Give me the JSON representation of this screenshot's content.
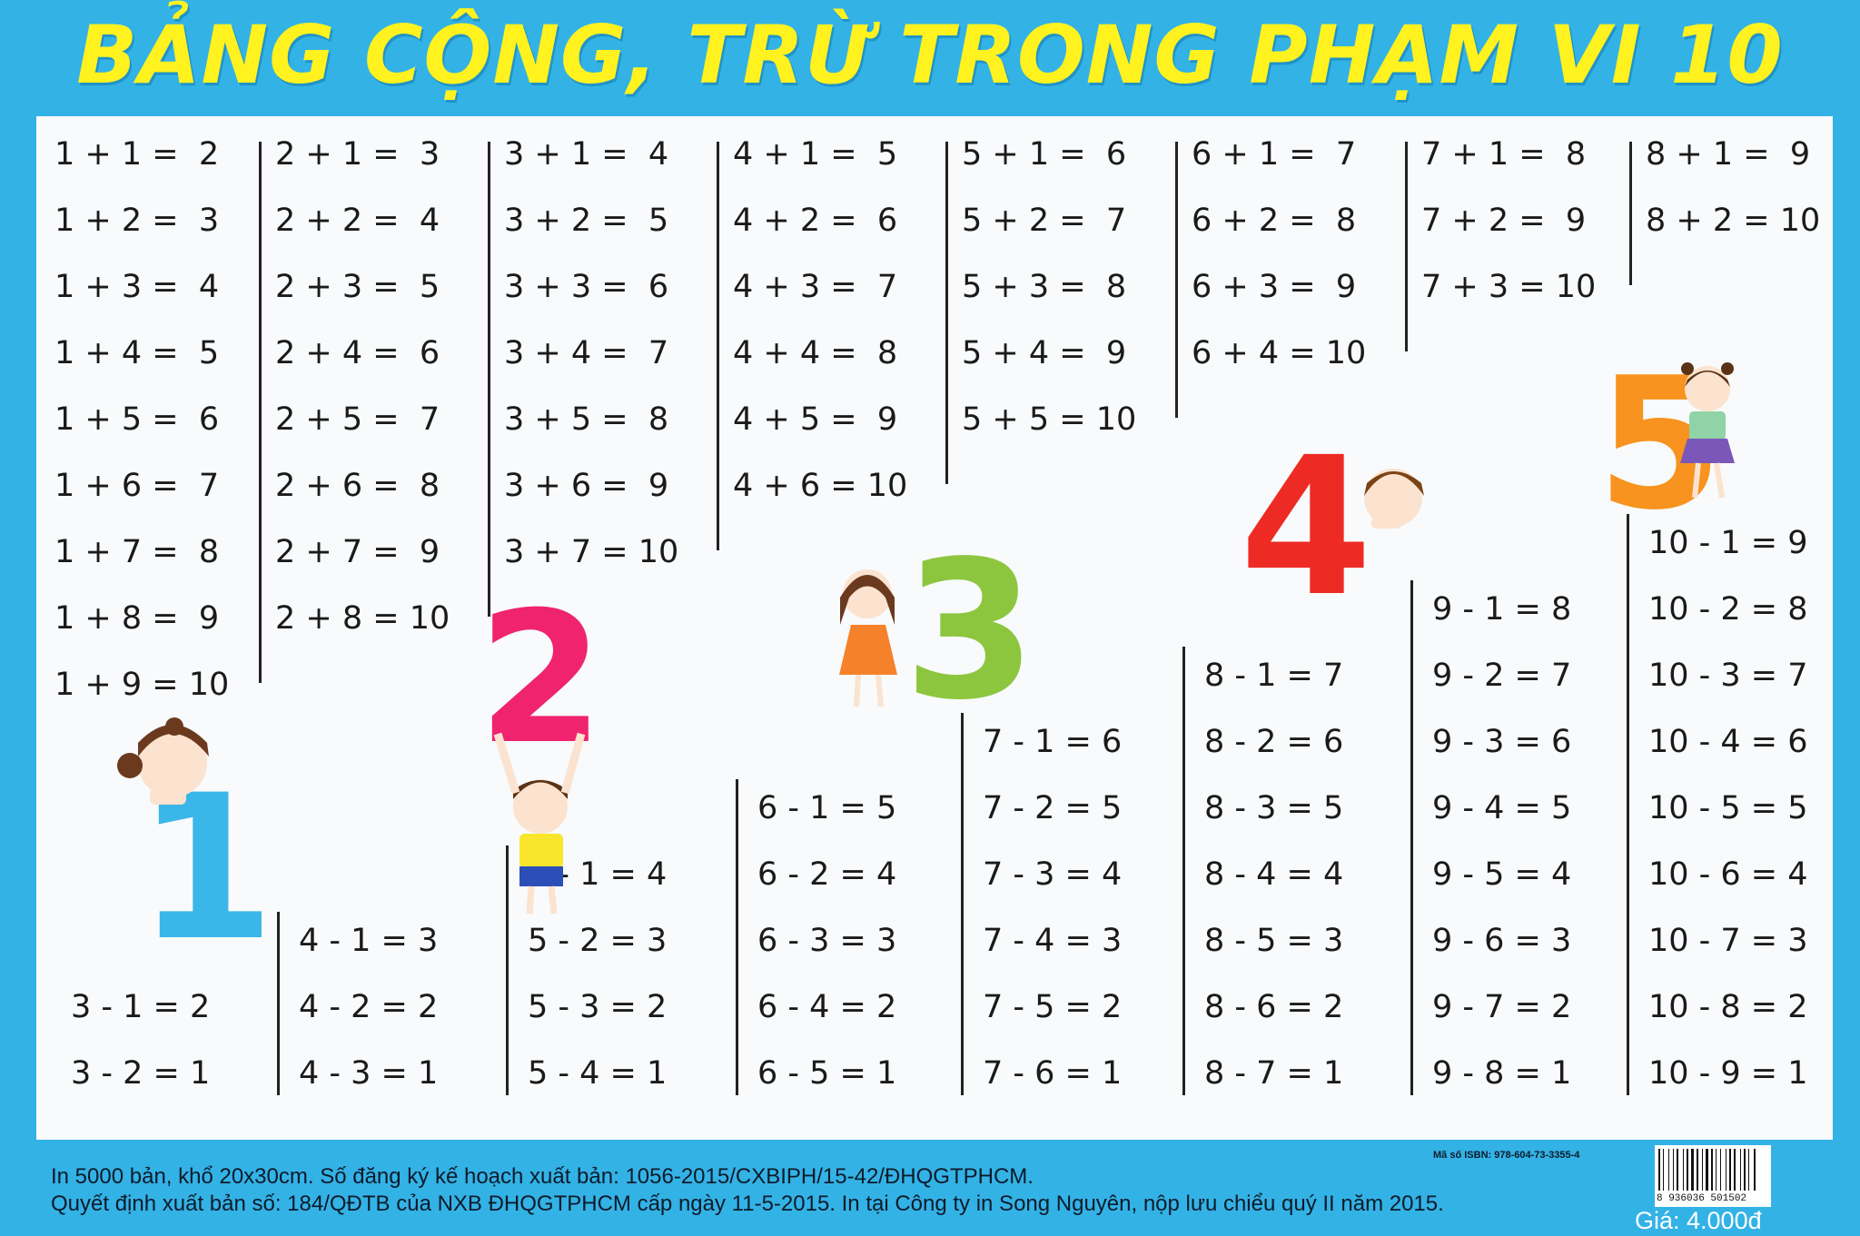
{
  "title": "BẢNG CỘNG, TRỪ TRONG PHẠM VI 10",
  "addition_columns": [
    [
      "1 + 1 =  2",
      "1 + 2 =  3",
      "1 + 3 =  4",
      "1 + 4 =  5",
      "1 + 5 =  6",
      "1 + 6 =  7",
      "1 + 7 =  8",
      "1 + 8 =  9",
      "1 + 9 = 10"
    ],
    [
      "2 + 1 =  3",
      "2 + 2 =  4",
      "2 + 3 =  5",
      "2 + 4 =  6",
      "2 + 5 =  7",
      "2 + 6 =  8",
      "2 + 7 =  9",
      "2 + 8 = 10"
    ],
    [
      "3 + 1 =  4",
      "3 + 2 =  5",
      "3 + 3 =  6",
      "3 + 4 =  7",
      "3 + 5 =  8",
      "3 + 6 =  9",
      "3 + 7 = 10"
    ],
    [
      "4 + 1 =  5",
      "4 + 2 =  6",
      "4 + 3 =  7",
      "4 + 4 =  8",
      "4 + 5 =  9",
      "4 + 6 = 10"
    ],
    [
      "5 + 1 =  6",
      "5 + 2 =  7",
      "5 + 3 =  8",
      "5 + 4 =  9",
      "5 + 5 = 10"
    ],
    [
      "6 + 1 =  7",
      "6 + 2 =  8",
      "6 + 3 =  9",
      "6 + 4 = 10"
    ],
    [
      "7 + 1 =  8",
      "7 + 2 =  9",
      "7 + 3 = 10"
    ],
    [
      "8 + 1 =  9",
      "8 + 2 = 10"
    ]
  ],
  "subtraction_columns": [
    [
      "3 - 1 = 2",
      "3 - 2 = 1"
    ],
    [
      "4 - 1 = 3",
      "4 - 2 = 2",
      "4 - 3 = 1"
    ],
    [
      "5 - 1 = 4",
      "5 - 2 = 3",
      "5 - 3 = 2",
      "5 - 4 = 1"
    ],
    [
      "6 - 1 = 5",
      "6 - 2 = 4",
      "6 - 3 = 3",
      "6 - 4 = 2",
      "6 - 5 = 1"
    ],
    [
      "7 - 1 = 6",
      "7 - 2 = 5",
      "7 - 3 = 4",
      "7 - 4 = 3",
      "7 - 5 = 2",
      "7 - 6 = 1"
    ],
    [
      "8 - 1 = 7",
      "8 - 2 = 6",
      "8 - 3 = 5",
      "8 - 4 = 4",
      "8 - 5 = 3",
      "8 - 6 = 2",
      "8 - 7 = 1"
    ],
    [
      "9 - 1 = 8",
      "9 - 2 = 7",
      "9 - 3 = 6",
      "9 - 4 = 5",
      "9 - 5 = 4",
      "9 - 6 = 3",
      "9 - 7 = 2",
      "9 - 8 = 1"
    ],
    [
      "10 - 1 = 9",
      "10 - 2 = 8",
      "10 - 3 = 7",
      "10 - 4 = 6",
      "10 - 5 = 5",
      "10 - 6 = 4",
      "10 - 7 = 3",
      "10 - 8 = 2",
      "10 - 9 = 1"
    ]
  ],
  "decor_digits": [
    {
      "text": "1",
      "color": "#3bb6e8"
    },
    {
      "text": "2",
      "color": "#f0236f"
    },
    {
      "text": "3",
      "color": "#8cc63f"
    },
    {
      "text": "4",
      "color": "#ee2a24"
    },
    {
      "text": "5",
      "color": "#f7931e"
    }
  ],
  "footer": {
    "line1": "In 5000 bản, khổ 20x30cm. Số đăng ký kế hoạch xuất bản: 1056-2015/CXBIPH/15-42/ĐHQGTPHCM.",
    "line2": "Quyết định xuất bản số: 184/QĐTB của NXB ĐHQGTPHCM cấp ngày 11-5-2015. In tại Công ty in Song Nguyên, nộp lưu chiểu quý II năm 2015."
  },
  "isbn": "Mã số ISBN: 978-604-73-3355-4",
  "barcode_number": "8 936036 501502",
  "price": "Giá: 4.000đ",
  "colors": {
    "background": "#33b2e6",
    "title": "#fff21f",
    "board": "#f8fafb"
  }
}
